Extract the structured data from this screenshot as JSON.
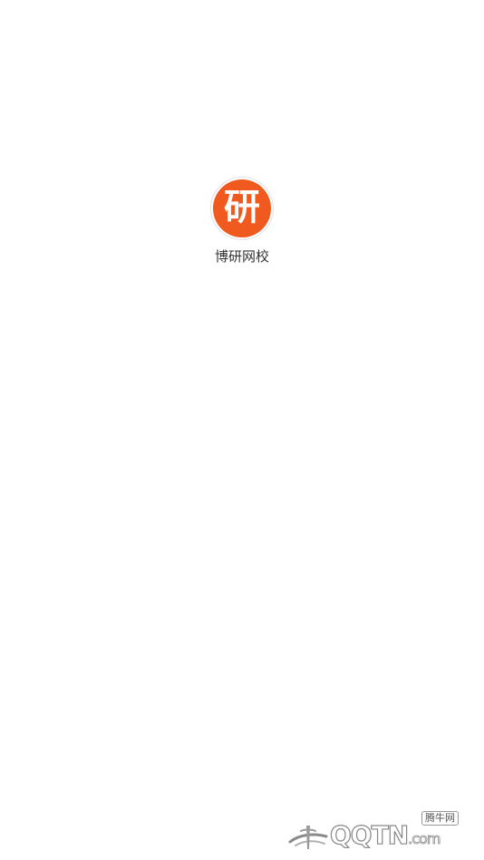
{
  "app": {
    "logo_char": "研",
    "name": "博研网校"
  },
  "colors": {
    "background": "#ffffff",
    "logo_accent": "#f15a1e",
    "app_name_text": "#333333"
  },
  "watermark": {
    "site_name": "腾牛网",
    "brand": "QQTN",
    "suffix": ".com",
    "emblem_icon": "swoosh-logo-icon"
  }
}
